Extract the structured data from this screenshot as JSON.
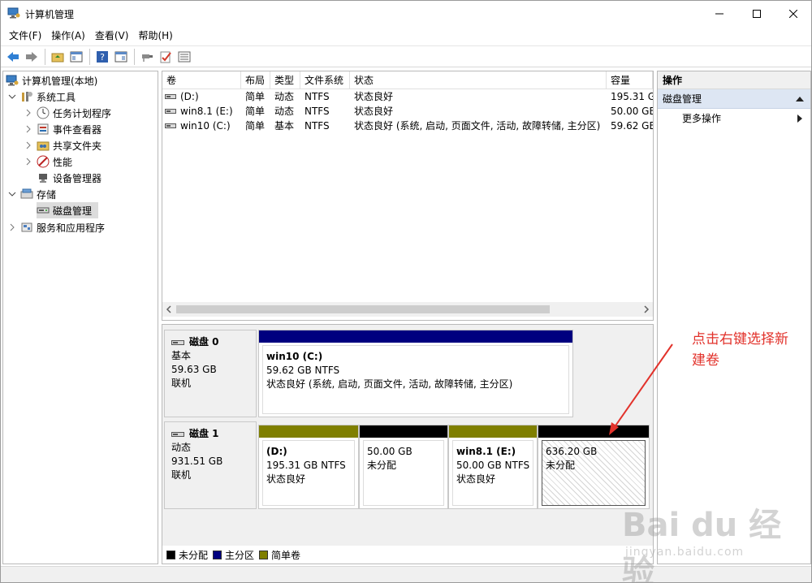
{
  "window": {
    "title": "计算机管理"
  },
  "menu": [
    {
      "label": "文件(F)"
    },
    {
      "label": "操作(A)"
    },
    {
      "label": "查看(V)"
    },
    {
      "label": "帮助(H)"
    }
  ],
  "tree": {
    "root": "计算机管理(本地)",
    "items": [
      {
        "label": "系统工具",
        "level": 1,
        "expanded": true
      },
      {
        "label": "任务计划程序",
        "level": 2
      },
      {
        "label": "事件查看器",
        "level": 2
      },
      {
        "label": "共享文件夹",
        "level": 2
      },
      {
        "label": "性能",
        "level": 2
      },
      {
        "label": "设备管理器",
        "level": 2
      },
      {
        "label": "存储",
        "level": 1,
        "expanded": true
      },
      {
        "label": "磁盘管理",
        "level": 2,
        "selected": true
      },
      {
        "label": "服务和应用程序",
        "level": 1
      }
    ]
  },
  "volume_list": {
    "columns": [
      "卷",
      "布局",
      "类型",
      "文件系统",
      "状态",
      "容量"
    ],
    "rows": [
      {
        "volume": "(D:)",
        "layout": "简单",
        "type": "动态",
        "fs": "NTFS",
        "status": "状态良好",
        "capacity": "195.31 G"
      },
      {
        "volume": "win8.1 (E:)",
        "layout": "简单",
        "type": "动态",
        "fs": "NTFS",
        "status": "状态良好",
        "capacity": "50.00 GB"
      },
      {
        "volume": "win10 (C:)",
        "layout": "简单",
        "type": "基本",
        "fs": "NTFS",
        "status": "状态良好 (系统, 启动, 页面文件, 活动, 故障转储, 主分区)",
        "capacity": "59.62 GB"
      }
    ]
  },
  "disks": [
    {
      "name": "磁盘 0",
      "type": "基本",
      "size": "59.63 GB",
      "state": "联机",
      "partitions": [
        {
          "name": "win10 (C:)",
          "size": "59.62 GB NTFS",
          "status": "状态良好 (系统, 启动, 页面文件, 活动, 故障转储, 主分区)",
          "bar_color": "#00007f"
        }
      ]
    },
    {
      "name": "磁盘 1",
      "type": "动态",
      "size": "931.51 GB",
      "state": "联机",
      "partitions": [
        {
          "name": "(D:)",
          "size": "195.31 GB NTFS",
          "status": "状态良好",
          "bar_color": "#7f7f00"
        },
        {
          "name": "",
          "size": "50.00 GB",
          "status": "未分配",
          "bar_color": "#000000"
        },
        {
          "name": "win8.1 (E:)",
          "size": "50.00 GB NTFS",
          "status": "状态良好",
          "bar_color": "#7f7f00"
        },
        {
          "name": "",
          "size": "636.20 GB",
          "status": "未分配",
          "bar_color": "#000000",
          "selected": true
        }
      ]
    }
  ],
  "legend": [
    {
      "label": "未分配",
      "color": "#000000"
    },
    {
      "label": "主分区",
      "color": "#00007f"
    },
    {
      "label": "简单卷",
      "color": "#7f7f00"
    }
  ],
  "actions": {
    "header": "操作",
    "section": "磁盘管理",
    "items": [
      "更多操作"
    ]
  },
  "annotation": {
    "text_line1": "点击右键选择新",
    "text_line2": "建卷",
    "color": "#e2322b"
  },
  "watermark": {
    "brand": "Bai du 经验",
    "url": "jingyan.baidu.com"
  }
}
